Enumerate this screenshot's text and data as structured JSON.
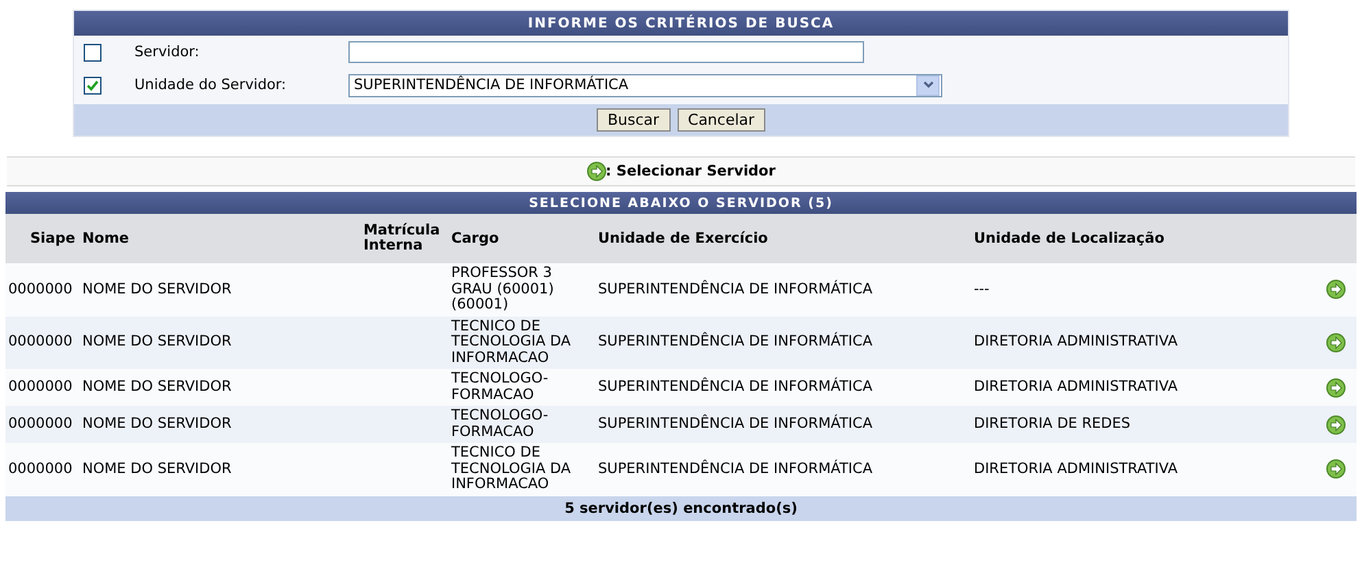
{
  "search_form": {
    "title": "INFORME OS CRITÉRIOS DE BUSCA",
    "fields": [
      {
        "kind": "text",
        "checked": false,
        "label": "Servidor:"
      },
      {
        "kind": "select",
        "checked": true,
        "label": "Unidade do Servidor:",
        "value": "SUPERINTENDÊNCIA DE INFORMÁTICA"
      }
    ],
    "buttons": [
      "Buscar",
      "Cancelar"
    ]
  },
  "legend": {
    "label": ": Selecionar Servidor"
  },
  "table": {
    "title": "SELECIONE ABAIXO O SERVIDOR (5)",
    "columns": [
      "Siape",
      "Nome",
      "Matrícula Interna",
      "Cargo",
      "Unidade de Exercício",
      "Unidade de Localização"
    ],
    "rows": [
      {
        "cells": [
          "0000000",
          "NOME DO SERVIDOR",
          "",
          "PROFESSOR 3 GRAU (60001) (60001)",
          "SUPERINTENDÊNCIA DE INFORMÁTICA",
          "---"
        ]
      },
      {
        "cells": [
          "0000000",
          "NOME DO SERVIDOR",
          "",
          "TECNICO DE TECNOLOGIA DA INFORMACAO",
          "SUPERINTENDÊNCIA DE INFORMÁTICA",
          "DIRETORIA ADMINISTRATIVA"
        ]
      },
      {
        "cells": [
          "0000000",
          "NOME DO SERVIDOR",
          "",
          "TECNOLOGO-FORMACAO",
          "SUPERINTENDÊNCIA DE INFORMÁTICA",
          "DIRETORIA ADMINISTRATIVA"
        ]
      },
      {
        "cells": [
          "0000000",
          "NOME DO SERVIDOR",
          "",
          "TECNOLOGO-FORMACAO",
          "SUPERINTENDÊNCIA DE INFORMÁTICA",
          "DIRETORIA DE REDES"
        ]
      },
      {
        "cells": [
          "0000000",
          "NOME DO SERVIDOR",
          "",
          "TECNICO DE TECNOLOGIA DA INFORMACAO",
          "SUPERINTENDÊNCIA DE INFORMÁTICA",
          "DIRETORIA ADMINISTRATIVA"
        ]
      }
    ],
    "footer": "5 servidor(es) encontrado(s)"
  }
}
